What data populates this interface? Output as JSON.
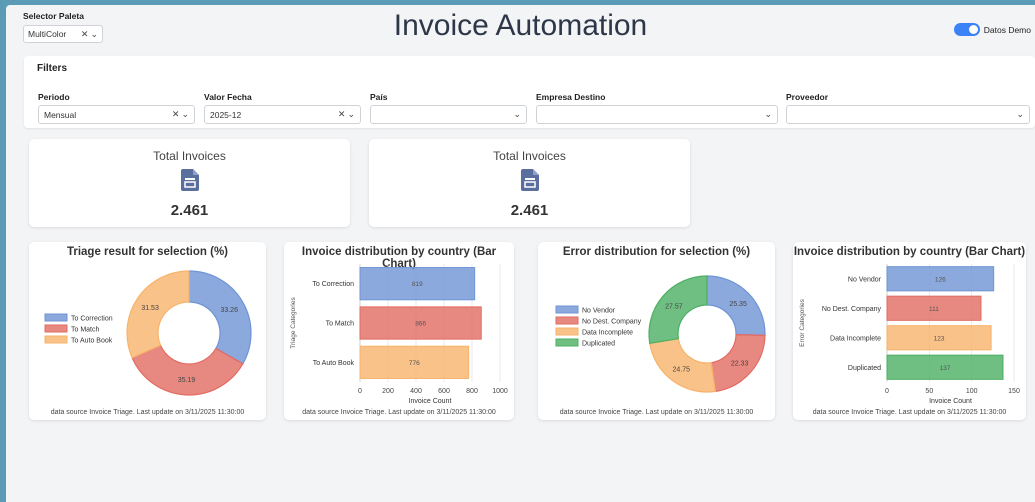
{
  "palette": {
    "label": "Selector Paleta",
    "value": "MultiColor"
  },
  "app_title": "Invoice Automation",
  "demo_toggle": {
    "label": "Datos Demo",
    "on": true,
    "color": "#3b82f6"
  },
  "filters": {
    "title": "Filters",
    "fields": [
      {
        "label": "Periodo",
        "value": "Mensual",
        "clearable": true
      },
      {
        "label": "Valor Fecha",
        "value": "2025-12",
        "clearable": true
      },
      {
        "label": "País",
        "value": "",
        "clearable": false
      },
      {
        "label": "Empresa Destino",
        "value": "",
        "clearable": false
      },
      {
        "label": "Proveedor",
        "value": "",
        "clearable": false
      }
    ]
  },
  "kpis": [
    {
      "title": "Total Invoices",
      "value": "2.461",
      "icon": "document-icon"
    },
    {
      "title": "Total Invoices",
      "value": "2.461",
      "icon": "document-icon"
    }
  ],
  "footnote": "data source Invoice Triage. Last update on 3/11/2025 11:30:00",
  "colors": {
    "blue": "#6f94d6",
    "red": "#e26b62",
    "orange": "#f7b36b",
    "green": "#4caf63",
    "icon": "#5a6f9e"
  },
  "chart_data": [
    {
      "type": "pie",
      "title": "Triage result for selection (%)",
      "categories": [
        "To Correction",
        "To Match",
        "To Auto Book"
      ],
      "values": [
        33.26,
        35.19,
        31.53
      ],
      "colors": [
        "#6f94d6",
        "#e26b62",
        "#f7b36b"
      ],
      "donut": true,
      "legend": "left"
    },
    {
      "type": "bar",
      "orientation": "horizontal",
      "title": "Invoice distribution by country (Bar Chart)",
      "categories": [
        "To Correction",
        "To Match",
        "To Auto Book"
      ],
      "values": [
        819,
        866,
        776
      ],
      "colors": [
        "#6f94d6",
        "#e26b62",
        "#f7b36b"
      ],
      "xlabel": "Invoice Count",
      "ylabel": "Triage Categories",
      "xlim": [
        0,
        1000
      ],
      "xticks": [
        0,
        200,
        400,
        600,
        800,
        1000
      ],
      "grid": true
    },
    {
      "type": "pie",
      "title": "Error distribution for selection (%)",
      "categories": [
        "No Vendor",
        "No Dest. Company",
        "Data Incomplete",
        "Duplicated"
      ],
      "values": [
        25.35,
        22.33,
        24.75,
        27.57
      ],
      "colors": [
        "#6f94d6",
        "#e26b62",
        "#f7b36b",
        "#4caf63"
      ],
      "donut": true,
      "legend": "left"
    },
    {
      "type": "bar",
      "orientation": "horizontal",
      "title": "Invoice distribution by country (Bar Chart)",
      "categories": [
        "No Vendor",
        "No Dest. Company",
        "Data Incomplete",
        "Duplicated"
      ],
      "values": [
        126,
        111,
        123,
        137
      ],
      "colors": [
        "#6f94d6",
        "#e26b62",
        "#f7b36b",
        "#4caf63"
      ],
      "xlabel": "Invoice Count",
      "ylabel": "Error Categories",
      "xlim": [
        0,
        150
      ],
      "xticks": [
        0,
        50,
        100,
        150
      ],
      "grid": true
    }
  ]
}
